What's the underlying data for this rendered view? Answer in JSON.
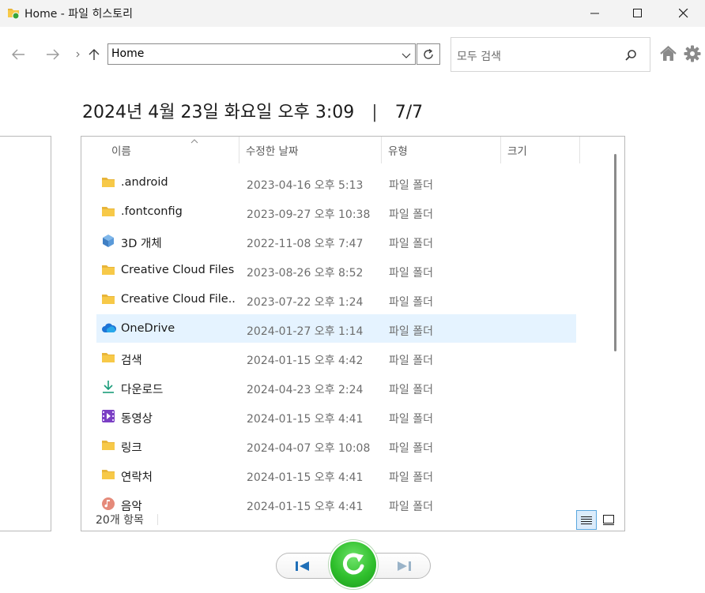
{
  "window": {
    "title": "Home - 파일 히스토리"
  },
  "toolbar": {
    "address": "Home",
    "search_placeholder": "모두 검색"
  },
  "history": {
    "date": "2024년 4월 23일 화요일 오후 3:09",
    "separator": "|",
    "position": "7/7"
  },
  "columns": [
    {
      "label": "이름"
    },
    {
      "label": "수정한 날짜"
    },
    {
      "label": "유형"
    },
    {
      "label": "크기"
    }
  ],
  "files": [
    {
      "name": ".android",
      "date": "2023-04-16 오후 5:13",
      "type": "파일 폴더",
      "icon": "folder-icon"
    },
    {
      "name": ".fontconfig",
      "date": "2023-09-27 오후 10:38",
      "type": "파일 폴더",
      "icon": "folder-icon"
    },
    {
      "name": "3D 개체",
      "date": "2022-11-08 오후 7:47",
      "type": "파일 폴더",
      "icon": "3d-objects-icon"
    },
    {
      "name": "Creative Cloud Files",
      "date": "2023-08-26 오후 8:52",
      "type": "파일 폴더",
      "icon": "folder-icon"
    },
    {
      "name": "Creative Cloud File...",
      "date": "2023-07-22 오후 1:24",
      "type": "파일 폴더",
      "icon": "folder-icon"
    },
    {
      "name": "OneDrive",
      "date": "2024-01-27 오후 1:14",
      "type": "파일 폴더",
      "icon": "onedrive-cloud-icon",
      "selected": true
    },
    {
      "name": "검색",
      "date": "2024-01-15 오후 4:42",
      "type": "파일 폴더",
      "icon": "folder-icon"
    },
    {
      "name": "다운로드",
      "date": "2024-04-23 오후 2:24",
      "type": "파일 폴더",
      "icon": "download-icon"
    },
    {
      "name": "동영상",
      "date": "2024-01-15 오후 4:41",
      "type": "파일 폴더",
      "icon": "video-icon"
    },
    {
      "name": "링크",
      "date": "2024-04-07 오후 10:08",
      "type": "파일 폴더",
      "icon": "folder-icon"
    },
    {
      "name": "연락처",
      "date": "2024-01-15 오후 4:41",
      "type": "파일 폴더",
      "icon": "folder-icon"
    },
    {
      "name": "음악",
      "date": "2024-01-15 오후 4:41",
      "type": "파일 폴더",
      "icon": "music-icon"
    }
  ],
  "status": {
    "item_count": "20개 항목"
  },
  "colors": {
    "folder": "#f7c948",
    "selection": "#e5f3ff",
    "restore_green": "#2fbf2c",
    "playback_blue": "#1f6fb8"
  }
}
